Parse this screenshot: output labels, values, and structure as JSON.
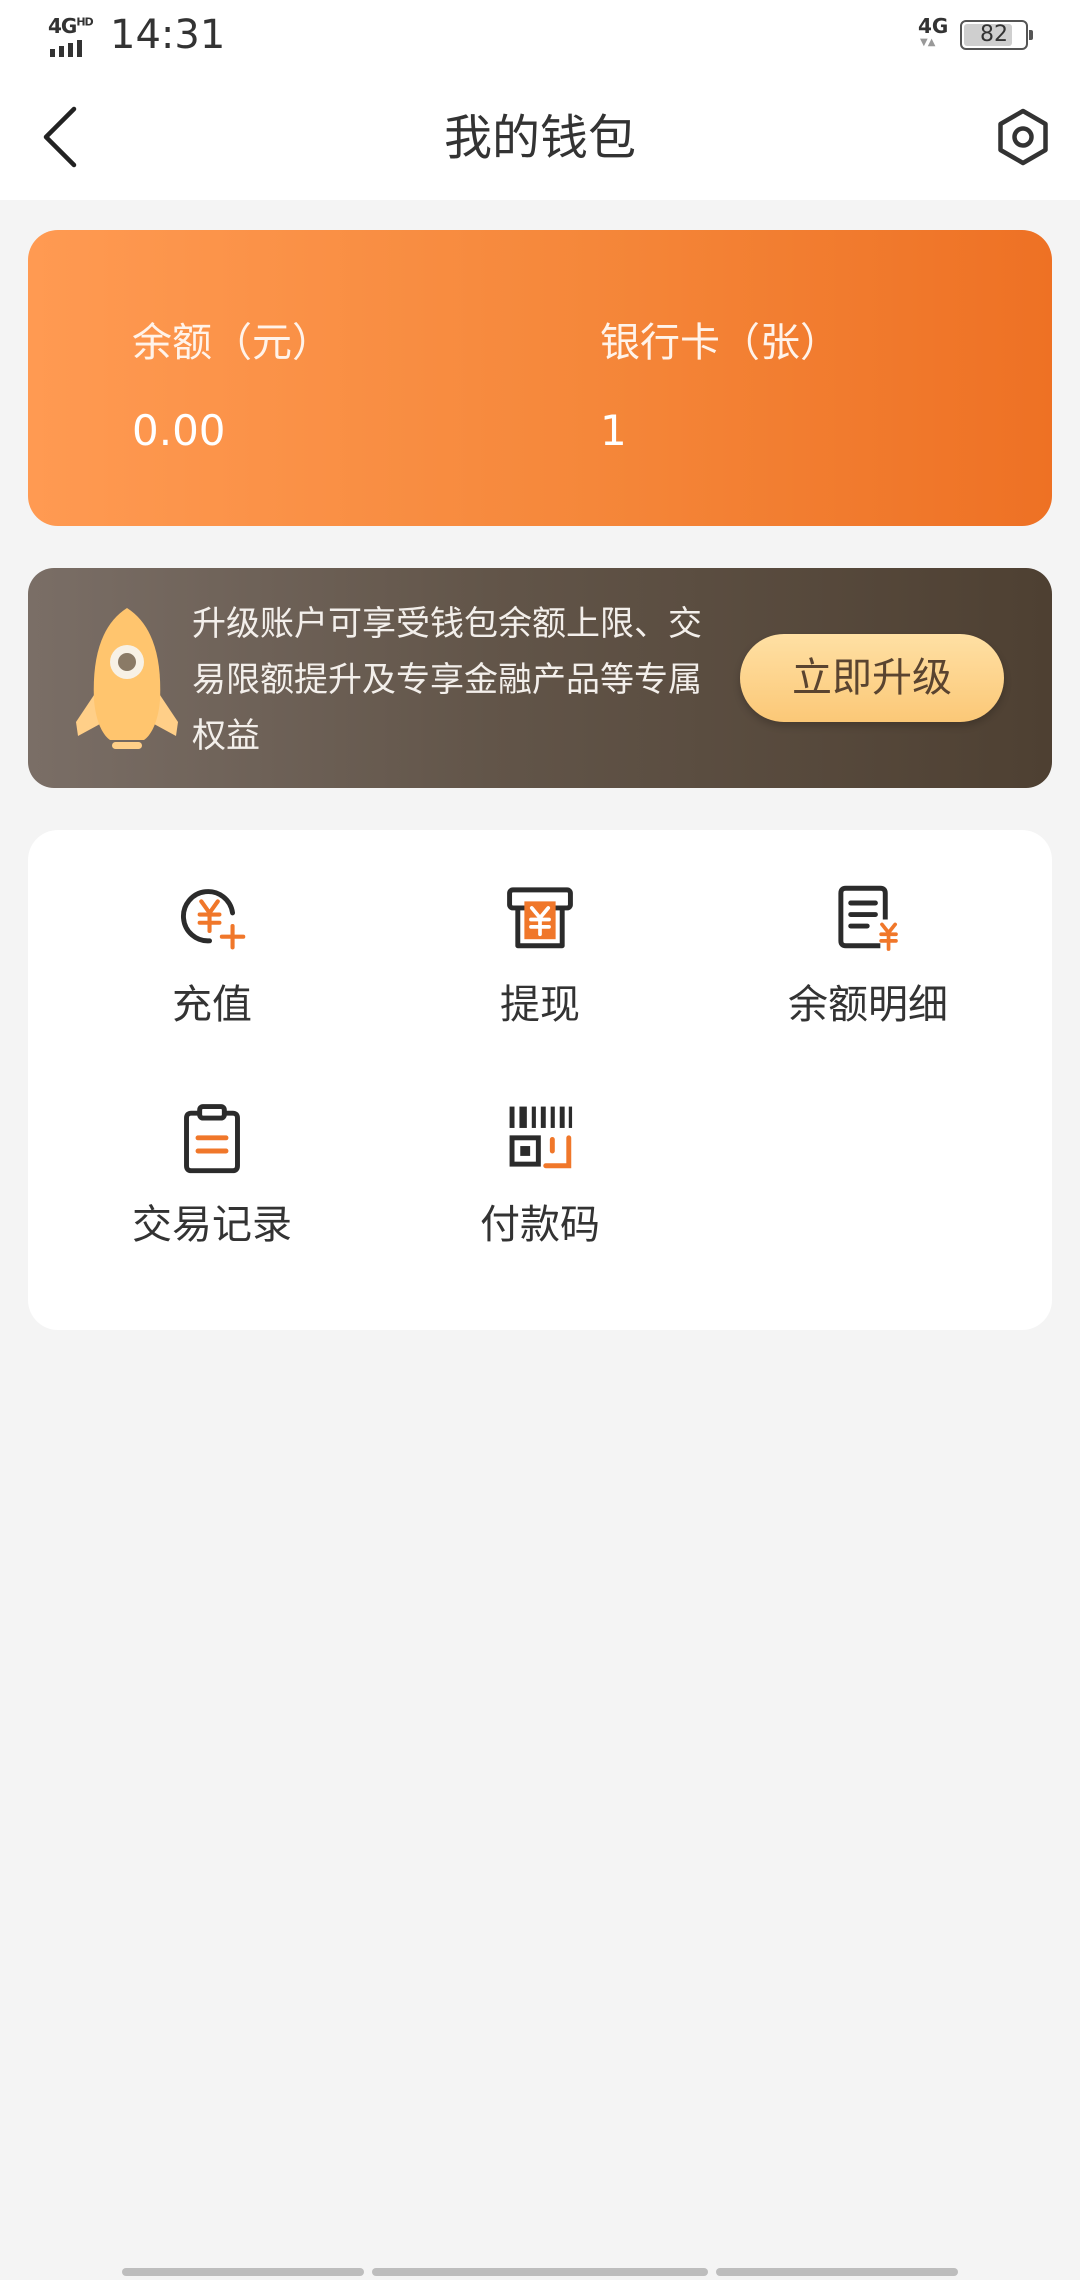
{
  "status_bar": {
    "network_left": "4G",
    "network_left_sup": "HD",
    "time": "14:31",
    "network_right": "4G",
    "battery": "82",
    "battery_level": 0.82
  },
  "header": {
    "title": "我的钱包"
  },
  "balance_card": {
    "balance_label": "余额（元）",
    "balance_value": "0.00",
    "cards_label": "银行卡（张）",
    "cards_value": "1"
  },
  "upgrade": {
    "text": "升级账户可享受钱包余额上限、交易限额提升及专享金融产品等专属权益",
    "button": "立即升级"
  },
  "actions": [
    {
      "label": "充值",
      "icon": "yuan-plus-icon"
    },
    {
      "label": "提现",
      "icon": "withdraw-icon"
    },
    {
      "label": "余额明细",
      "icon": "balance-detail-icon"
    },
    {
      "label": "交易记录",
      "icon": "clipboard-icon"
    },
    {
      "label": "付款码",
      "icon": "barcode-icon"
    }
  ],
  "colors": {
    "accent": "#f0772a",
    "card_gradient_start": "#ff9a52",
    "card_gradient_end": "#ee7124",
    "banner_bg": "#5e5144",
    "button_bg": "#fcd18a"
  }
}
